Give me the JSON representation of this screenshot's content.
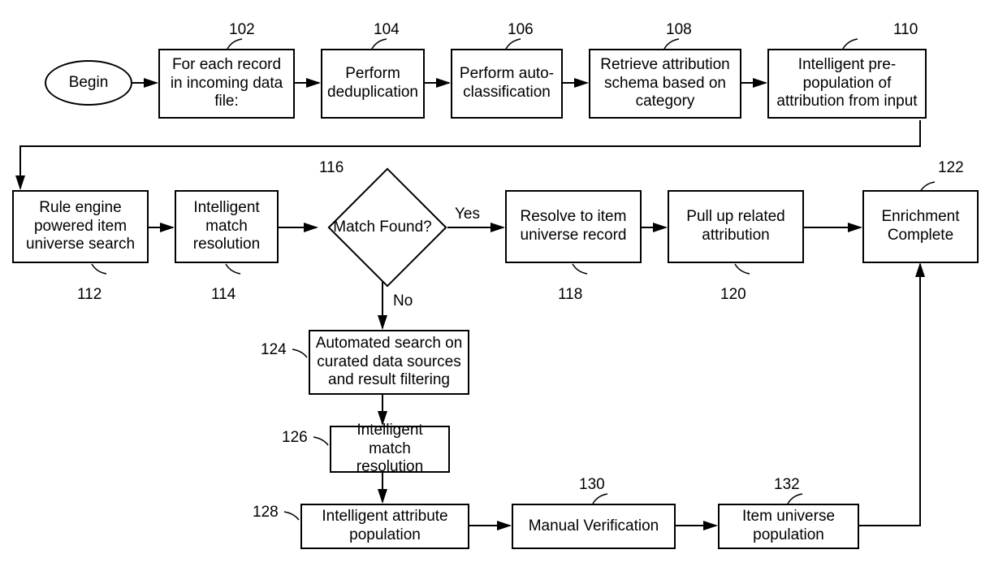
{
  "nodes": {
    "begin": "Begin",
    "n102": "For each record in incoming data file:",
    "n104": "Perform deduplication",
    "n106": "Perform auto-classification",
    "n108": "Retrieve attribution schema based on category",
    "n110": "Intelligent pre-population of attribution from input",
    "n112": "Rule engine powered item universe search",
    "n114": "Intelligent match resolution",
    "n116": "Match Found?",
    "n118": "Resolve to item universe record",
    "n120": "Pull up related attribution",
    "n122": "Enrichment Complete",
    "n124": "Automated search on curated data sources and result filtering",
    "n126": "Intelligent match resolution",
    "n128": "Intelligent attribute population",
    "n130": "Manual Verification",
    "n132": "Item universe population"
  },
  "refs": {
    "r102": "102",
    "r104": "104",
    "r106": "106",
    "r108": "108",
    "r110": "110",
    "r112": "112",
    "r114": "114",
    "r116": "116",
    "r118": "118",
    "r120": "120",
    "r122": "122",
    "r124": "124",
    "r126": "126",
    "r128": "128",
    "r130": "130",
    "r132": "132"
  },
  "labels": {
    "yes": "Yes",
    "no": "No"
  }
}
